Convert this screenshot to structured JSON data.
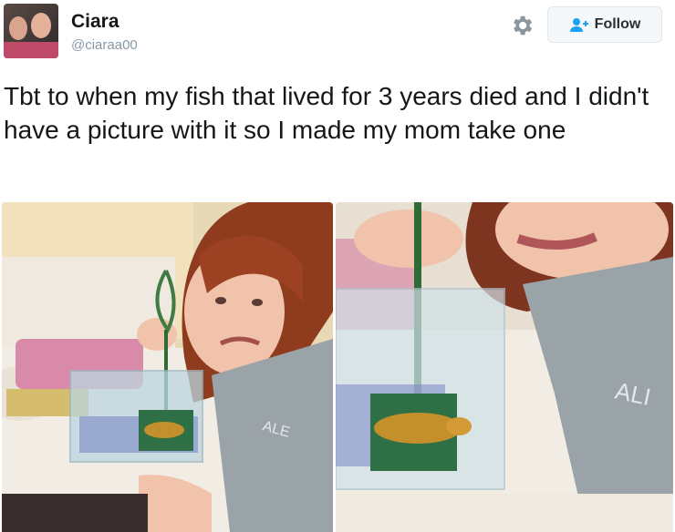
{
  "user": {
    "name": "Ciara",
    "handle": "@ciaraa00"
  },
  "follow_label": "Follow",
  "tweet_text": "Tbt to when my fish that lived for 3 years died and I didn't have a picture with it so I made my mom take one",
  "icons": {
    "settings": "gear-icon",
    "follow": "add-user-icon"
  },
  "colors": {
    "follow_icon": "#1da1f2",
    "handle": "#8899a6"
  }
}
